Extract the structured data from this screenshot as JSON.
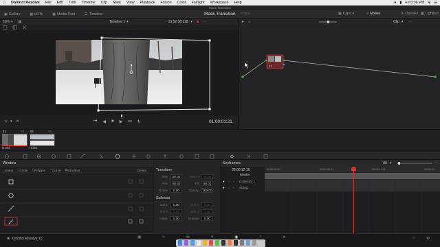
{
  "menubar": {
    "apple": "",
    "items": [
      "DaVinci Resolve",
      "File",
      "Edit",
      "Trim",
      "Timeline",
      "Clip",
      "Mark",
      "View",
      "Playback",
      "Fusion",
      "Color",
      "Fairlight",
      "Workspace",
      "Help"
    ],
    "clock": "Fri 6:06 PM"
  },
  "title_strip": "Mask Transition",
  "toolbar": {
    "left": [
      "Gallery",
      "LUTs",
      "Media Pool",
      "Timeline"
    ],
    "project_title": "Mask Transition",
    "status": "Edited",
    "right": [
      "Clips",
      "Nodes",
      "OpenFX",
      "Lightbox"
    ]
  },
  "viewer": {
    "zoom": "50%",
    "timeline_name": "Timeline 1",
    "source_timecode": "13:52:38:118",
    "timecode": "01:00:01:21"
  },
  "node_editor": {
    "mode": "Clip",
    "node_label": "01"
  },
  "clips": [
    {
      "number": "01",
      "track": "V2",
      "codec": "H.264"
    },
    {
      "number": "02",
      "track": "V1",
      "codec": "H.264"
    }
  ],
  "window_panel": {
    "title": "Window",
    "tools": [
      "Linear",
      "Circle",
      "Polygon",
      "Curve",
      "Gradient"
    ],
    "delete_label": "Delete"
  },
  "transform": {
    "title": "Transform",
    "rows": [
      {
        "l1": "Size",
        "v1": "50.00",
        "l2": "Aspect",
        "v2": "50.00",
        "dim2": true
      },
      {
        "l1": "Pan",
        "v1": "50.00",
        "l2": "Tilt",
        "v2": "50.00",
        "dim2": false
      },
      {
        "l1": "Rotate",
        "v1": "0.00",
        "l2": "Opacity",
        "v2": "100.00",
        "dim2": false
      }
    ],
    "softness_title": "Softness",
    "softness_rows": [
      {
        "l1": "Soft 1",
        "v1": "0.00",
        "dim1": false,
        "l2": "Soft 2",
        "v2": "0.00",
        "dim2": true
      },
      {
        "l1": "Soft 3",
        "v1": "0.00",
        "dim1": true,
        "l2": "Soft 4",
        "v2": "0.00",
        "dim2": true
      },
      {
        "l1": "Inside",
        "v1": "0.00",
        "dim1": false,
        "l2": "Outside",
        "v2": "0.00",
        "dim2": false
      }
    ]
  },
  "keyframes": {
    "title": "Keyframes",
    "filter": "All",
    "timecode": "00:00:12:16",
    "ruler": [
      "00:00:00:00",
      "00:00:03:07",
      "00:00:06:21",
      "00:00:10:14",
      "00:00:14:11",
      "00:00:20"
    ],
    "tracks": [
      "Master",
      "Corrector 1",
      "Sizing"
    ]
  },
  "bottom": {
    "app_name": "DaVinci Resolve 15"
  },
  "colors": {
    "accent_red": "#e0322d",
    "menubar_bg": "#ebebeb",
    "panel_bg": "#202023"
  }
}
